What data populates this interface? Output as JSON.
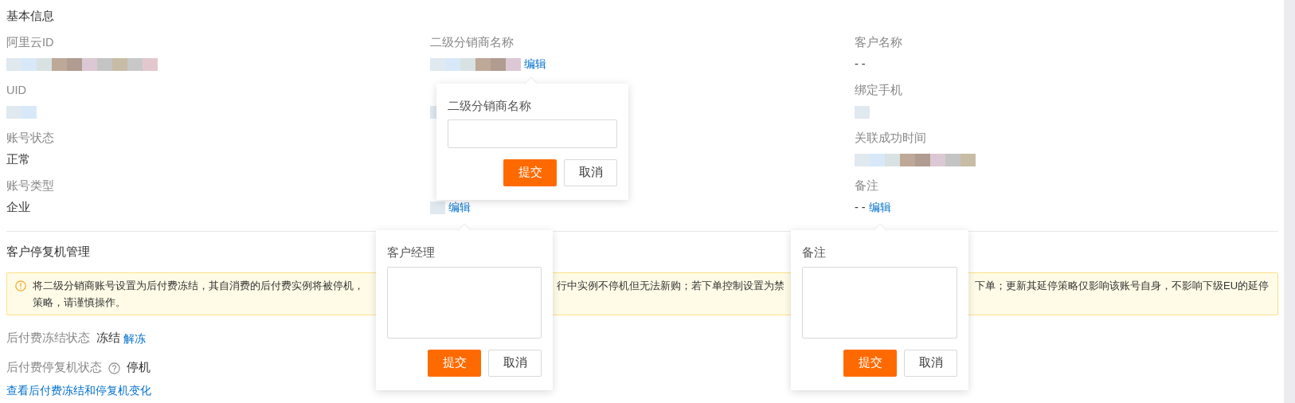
{
  "basic_info": {
    "title": "基本信息",
    "columns": [
      [
        {
          "label": "阿里云ID",
          "value": {
            "kind": "redacted"
          }
        },
        {
          "label": "UID",
          "value": {
            "kind": "redacted"
          }
        },
        {
          "label": "账号状态",
          "value": {
            "kind": "text",
            "text": "正常"
          }
        },
        {
          "label": "账号类型",
          "value": {
            "kind": "text",
            "text": "企业"
          }
        }
      ],
      [
        {
          "label": "二级分销商名称",
          "value": {
            "kind": "redacted"
          },
          "action": "编辑"
        },
        {
          "value": {
            "kind": "redacted"
          }
        },
        {},
        {
          "value": {
            "kind": "redacted"
          },
          "action": "编辑"
        }
      ],
      [
        {
          "label": "客户名称",
          "value": {
            "kind": "text",
            "text": "- -"
          }
        },
        {
          "label": "绑定手机",
          "value": {
            "kind": "redacted"
          }
        },
        {
          "label": "关联成功时间",
          "value": {
            "kind": "redacted"
          }
        },
        {
          "label": "备注",
          "value": {
            "kind": "text",
            "text": "- -"
          },
          "action": "编辑"
        }
      ]
    ]
  },
  "stop_management": {
    "title": "客户停复机管理",
    "alert": {
      "lines": [
        [
          "将二级分销商账号设置为后付费冻结，其自消费的后付费实例将被停机，",
          "行中实例不停机但无法新购；若下单控制设置为禁",
          "下单；更新其延停策略仅影响该账号自身，不影响下级EU的延停"
        ],
        [
          "策略，请谨慎操作。"
        ]
      ]
    },
    "statuses": [
      {
        "label": "后付费冻结状态",
        "help": false,
        "value": "冻结",
        "action": "解冻"
      },
      {
        "label": "后付费停复机状态",
        "help": true,
        "value": "停机"
      }
    ],
    "link": "查看后付费冻结和停复机变化"
  },
  "popovers": [
    {
      "label": "二级分销商名称",
      "kind": "input",
      "buttons": [
        {
          "label": "提交",
          "kind": "primary"
        },
        {
          "label": "取消",
          "kind": "secondary"
        }
      ]
    },
    {
      "label": "客户经理",
      "kind": "textarea",
      "buttons": [
        {
          "label": "提交",
          "kind": "primary"
        },
        {
          "label": "取消",
          "kind": "secondary"
        }
      ]
    },
    {
      "label": "备注",
      "kind": "textarea",
      "buttons": [
        {
          "label": "提交",
          "kind": "primary"
        },
        {
          "label": "取消",
          "kind": "secondary"
        }
      ]
    }
  ]
}
